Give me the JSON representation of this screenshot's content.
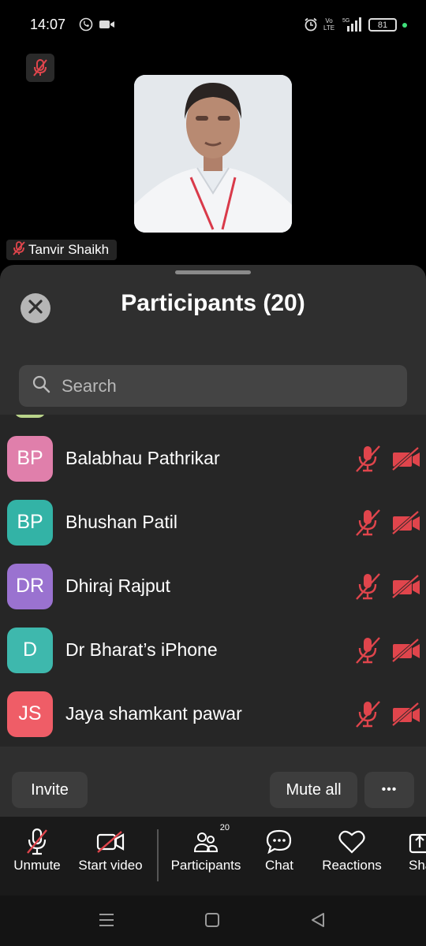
{
  "status": {
    "time": "14:07",
    "battery": "81",
    "network": "5G",
    "volte": "Vo LTE"
  },
  "video": {
    "speaker_name": "Tanvir Shaikh"
  },
  "participants_panel": {
    "title": "Participants (20)",
    "search_placeholder": "Search",
    "participants": [
      {
        "initials": "BP",
        "name": "Balabhau Pathrikar",
        "avatar_color": "#e07fab"
      },
      {
        "initials": "BP",
        "name": "Bhushan Patil",
        "avatar_color": "#33b3a6"
      },
      {
        "initials": "DR",
        "name": "Dhiraj Rajput",
        "avatar_color": "#9a72d0"
      },
      {
        "initials": "D",
        "name": "Dr Bharat’s iPhone",
        "avatar_color": "#3eb8ad"
      },
      {
        "initials": "JS",
        "name": "Jaya shamkant pawar",
        "avatar_color": "#ef5d67"
      }
    ],
    "invite_label": "Invite",
    "mute_all_label": "Mute all",
    "more_label": "•••"
  },
  "toolbar": {
    "unmute": "Unmute",
    "start_video": "Start video",
    "participants": "Participants",
    "participants_count": "20",
    "chat": "Chat",
    "reactions": "Reactions",
    "share": "Sha"
  },
  "colors": {
    "muted_red": "#e0454c",
    "sheet_bg": "#2f2f2f",
    "list_bg": "#262626"
  }
}
